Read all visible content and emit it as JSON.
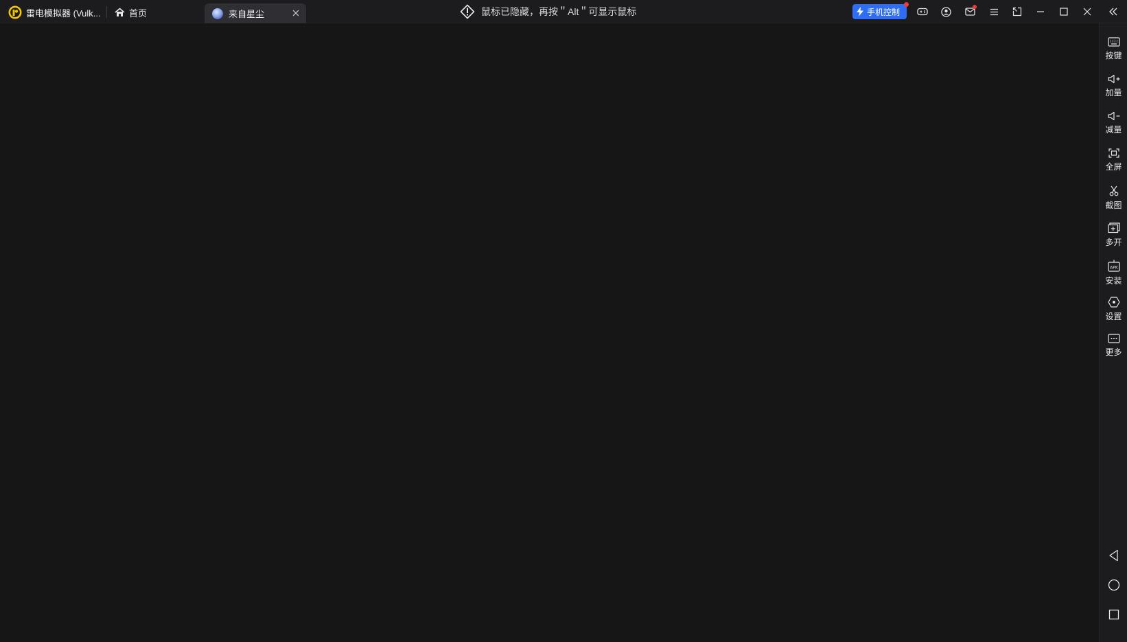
{
  "titlebar": {
    "app_title": "雷电模拟器 (Vulk...",
    "home_tab_label": "首页",
    "game_tab_label": "来自星尘",
    "notice": "鼠标已隐藏，再按＂Alt＂可显示鼠标",
    "phone_control_label": "手机控制"
  },
  "sidebar": {
    "items": [
      {
        "label": "按键",
        "icon": "keyboard-icon"
      },
      {
        "label": "加量",
        "icon": "volume-up-icon"
      },
      {
        "label": "减量",
        "icon": "volume-down-icon"
      },
      {
        "label": "全屏",
        "icon": "fullscreen-icon"
      },
      {
        "label": "截图",
        "icon": "scissors-icon"
      },
      {
        "label": "多开",
        "icon": "multi-instance-icon"
      },
      {
        "label": "安装",
        "icon": "apk-install-icon"
      },
      {
        "label": "设置",
        "icon": "settings-icon"
      },
      {
        "label": "更多",
        "icon": "more-icon"
      }
    ],
    "nav": [
      "back-icon",
      "home-circle-icon",
      "recents-icon"
    ]
  },
  "colors": {
    "background": "#161617",
    "titlebar": "#1c1c1f",
    "active_tab": "#2e2e33",
    "accent": "#2f6df5",
    "badge": "#f03a3a",
    "logo": "#f5c400"
  }
}
